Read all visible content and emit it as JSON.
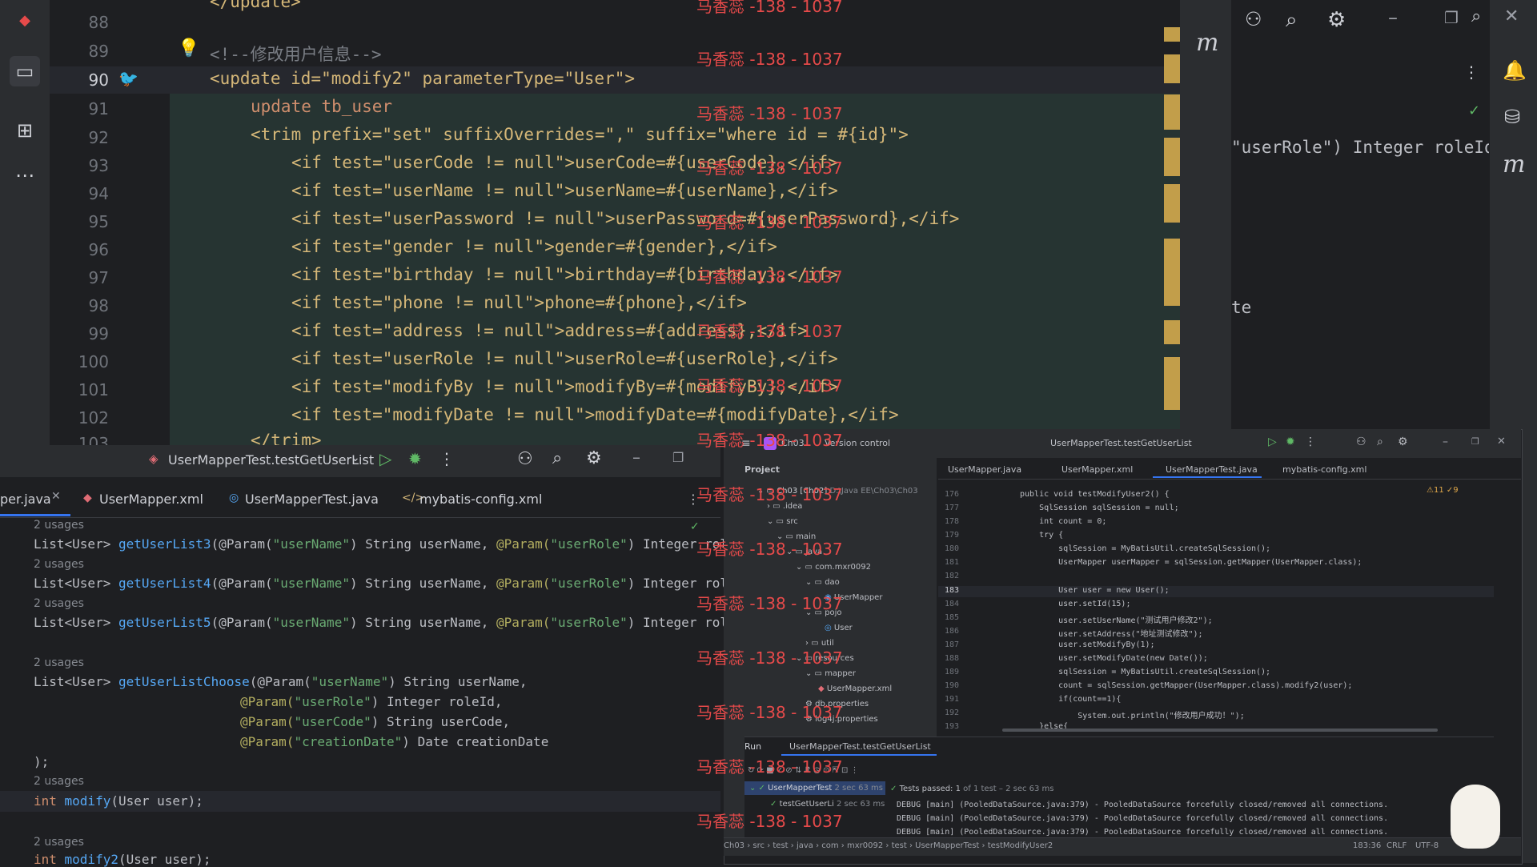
{
  "main_editor": {
    "comment_line": "<!--修改用户信息-->",
    "lines": [
      {
        "no": "88",
        "text": "</update>"
      },
      {
        "no": "89",
        "text": "<!--修改用户信息-->"
      },
      {
        "no": "90",
        "text": "<update id=\"modify2\" parameterType=\"User\">"
      },
      {
        "no": "91",
        "text": "update tb_user"
      },
      {
        "no": "92",
        "text": "<trim prefix=\"set\" suffixOverrides=\",\" suffix=\"where id = #{id}\">"
      },
      {
        "no": "93",
        "text": "<if test=\"userCode != null\">userCode=#{userCode},</if>"
      },
      {
        "no": "94",
        "text": "<if test=\"userName != null\">userName=#{userName},</if>"
      },
      {
        "no": "95",
        "text": "<if test=\"userPassword != null\">userPassword=#{userPassword},</if>"
      },
      {
        "no": "96",
        "text": "<if test=\"gender != null\">gender=#{gender},</if>"
      },
      {
        "no": "97",
        "text": "<if test=\"birthday != null\">birthday=#{birthday},</if>"
      },
      {
        "no": "98",
        "text": "<if test=\"phone != null\">phone=#{phone},</if>"
      },
      {
        "no": "99",
        "text": "<if test=\"address != null\">address=#{address},</if>"
      },
      {
        "no": "100",
        "text": "<if test=\"userRole != null\">userRole=#{userRole},</if>"
      },
      {
        "no": "101",
        "text": "<if test=\"modifyBy != null\">modifyBy=#{modifyBy},</if>"
      },
      {
        "no": "102",
        "text": "<if test=\"modifyDate != null\">modifyDate=#{modifyDate},</if>"
      },
      {
        "no": "103",
        "text": "</trim>"
      }
    ],
    "right_peek": [
      "\"userRole\") Integer roleId)",
      "te"
    ]
  },
  "watermark": "马香蕊 -138 - 1037",
  "bottom_left": {
    "run_config": "UserMapperTest.testGetUserList",
    "tabs": [
      "per.java",
      "UserMapper.xml",
      "UserMapperTest.java",
      "mybatis-config.xml"
    ],
    "usages": "2 usages",
    "code": {
      "l1_type": "List<User> ",
      "l1_fn": "getUserList3",
      "l2_fn": "getUserList4",
      "l3_fn": "getUserList5",
      "param_prefix": "(@Param(",
      "s_username": "\"userName\"",
      "t_string_username": ") String userName, ",
      "param2": "@Param(",
      "s_userrole": "\"userRole\"",
      "t_integer_roleid": ") Integer roleId)",
      "choose_fn": "getUserListChoose",
      "choose_l1_tail": ") String userName,",
      "choose_l2_tail": ") Integer roleId,",
      "s_usercode": "\"userCode\"",
      "choose_l3_tail": ") String userCode,",
      "s_creationdate": "\"creationDate\"",
      "choose_l4_tail": ") Date creationDate",
      "close": ");",
      "int_kw": "int ",
      "modify_fn": "modify",
      "modify_args": "(User user);",
      "modify2_fn": "modify2"
    }
  },
  "float_window": {
    "project_name": "Ch03",
    "version_control": "Version control",
    "run_config": "UserMapperTest.testGetUserList",
    "project_label": "Project",
    "tabs": [
      "UserMapper.java",
      "UserMapper.xml",
      "UserMapperTest.java",
      "mybatis-config.xml"
    ],
    "tree": [
      {
        "label": "Ch03 [Ch02]",
        "extra": "D:\\Java EE\\Ch03\\Ch03"
      },
      {
        "label": ".idea"
      },
      {
        "label": "src"
      },
      {
        "label": "main"
      },
      {
        "label": "java"
      },
      {
        "label": "com.mxr0092"
      },
      {
        "label": "dao"
      },
      {
        "label": "UserMapper"
      },
      {
        "label": "pojo"
      },
      {
        "label": "User"
      },
      {
        "label": "util"
      },
      {
        "label": "resources"
      },
      {
        "label": "mapper"
      },
      {
        "label": "UserMapper.xml"
      },
      {
        "label": "db.properties"
      },
      {
        "label": "log4j.properties"
      }
    ],
    "code_lines": [
      {
        "no": "176",
        "text": "public void testModifyUser2() {"
      },
      {
        "no": "177",
        "text": "    SqlSession sqlSession = null;"
      },
      {
        "no": "178",
        "text": "    int count = 0;"
      },
      {
        "no": "179",
        "text": "    try {"
      },
      {
        "no": "180",
        "text": "        sqlSession = MyBatisUtil.createSqlSession();"
      },
      {
        "no": "181",
        "text": "        UserMapper userMapper = sqlSession.getMapper(UserMapper.class);"
      },
      {
        "no": "182",
        "text": ""
      },
      {
        "no": "183",
        "text": "        User user = new User();"
      },
      {
        "no": "184",
        "text": "        user.setId(15);"
      },
      {
        "no": "185",
        "text": "        user.setUserName(\"测试用户修改2\");"
      },
      {
        "no": "186",
        "text": "        user.setAddress(\"地址测试修改\");"
      },
      {
        "no": "187",
        "text": "        user.setModifyBy(1);"
      },
      {
        "no": "188",
        "text": "        user.setModifyDate(new Date());"
      },
      {
        "no": "189",
        "text": "        sqlSession = MyBatisUtil.createSqlSession();"
      },
      {
        "no": "190",
        "text": "        count = sqlSession.getMapper(UserMapper.class).modify2(user);"
      },
      {
        "no": "191",
        "text": "        if(count==1){"
      },
      {
        "no": "192",
        "text": "            System.out.println(\"修改用户成功！\");"
      },
      {
        "no": "193",
        "text": "    }else{"
      }
    ],
    "inspections": "⚠11 ✓9",
    "run": {
      "label": "Run",
      "tab": "UserMapperTest.testGetUserList",
      "tree_root": "UserMapperTest",
      "tree_root_time": "2 sec 63 ms",
      "tree_child": "testGetUserLi",
      "tree_child_time": "2 sec 63 ms",
      "passed": "Tests passed: 1",
      "passed_detail": "of 1 test – 2 sec 63 ms",
      "log": [
        "DEBUG [main] (PooledDataSource.java:379) - PooledDataSource forcefully closed/removed all connections.",
        "DEBUG [main] (PooledDataSource.java:379) - PooledDataSource forcefully closed/removed all connections.",
        "DEBUG [main] (PooledDataSource.java:379) - PooledDataSource forcefully closed/removed all connections."
      ]
    },
    "breadcrumb": [
      "Ch03",
      "src",
      "test",
      "java",
      "com",
      "mxr0092",
      "test",
      "UserMapperTest",
      "testModifyUser2"
    ],
    "position": "183:36",
    "line_sep": "CRLF",
    "encoding": "UTF-8"
  },
  "colors": {
    "accent": "#3574f0",
    "watermark": "#e64a4a",
    "tag": "#d5b778",
    "string": "#6aab73",
    "function": "#56a8f5"
  }
}
